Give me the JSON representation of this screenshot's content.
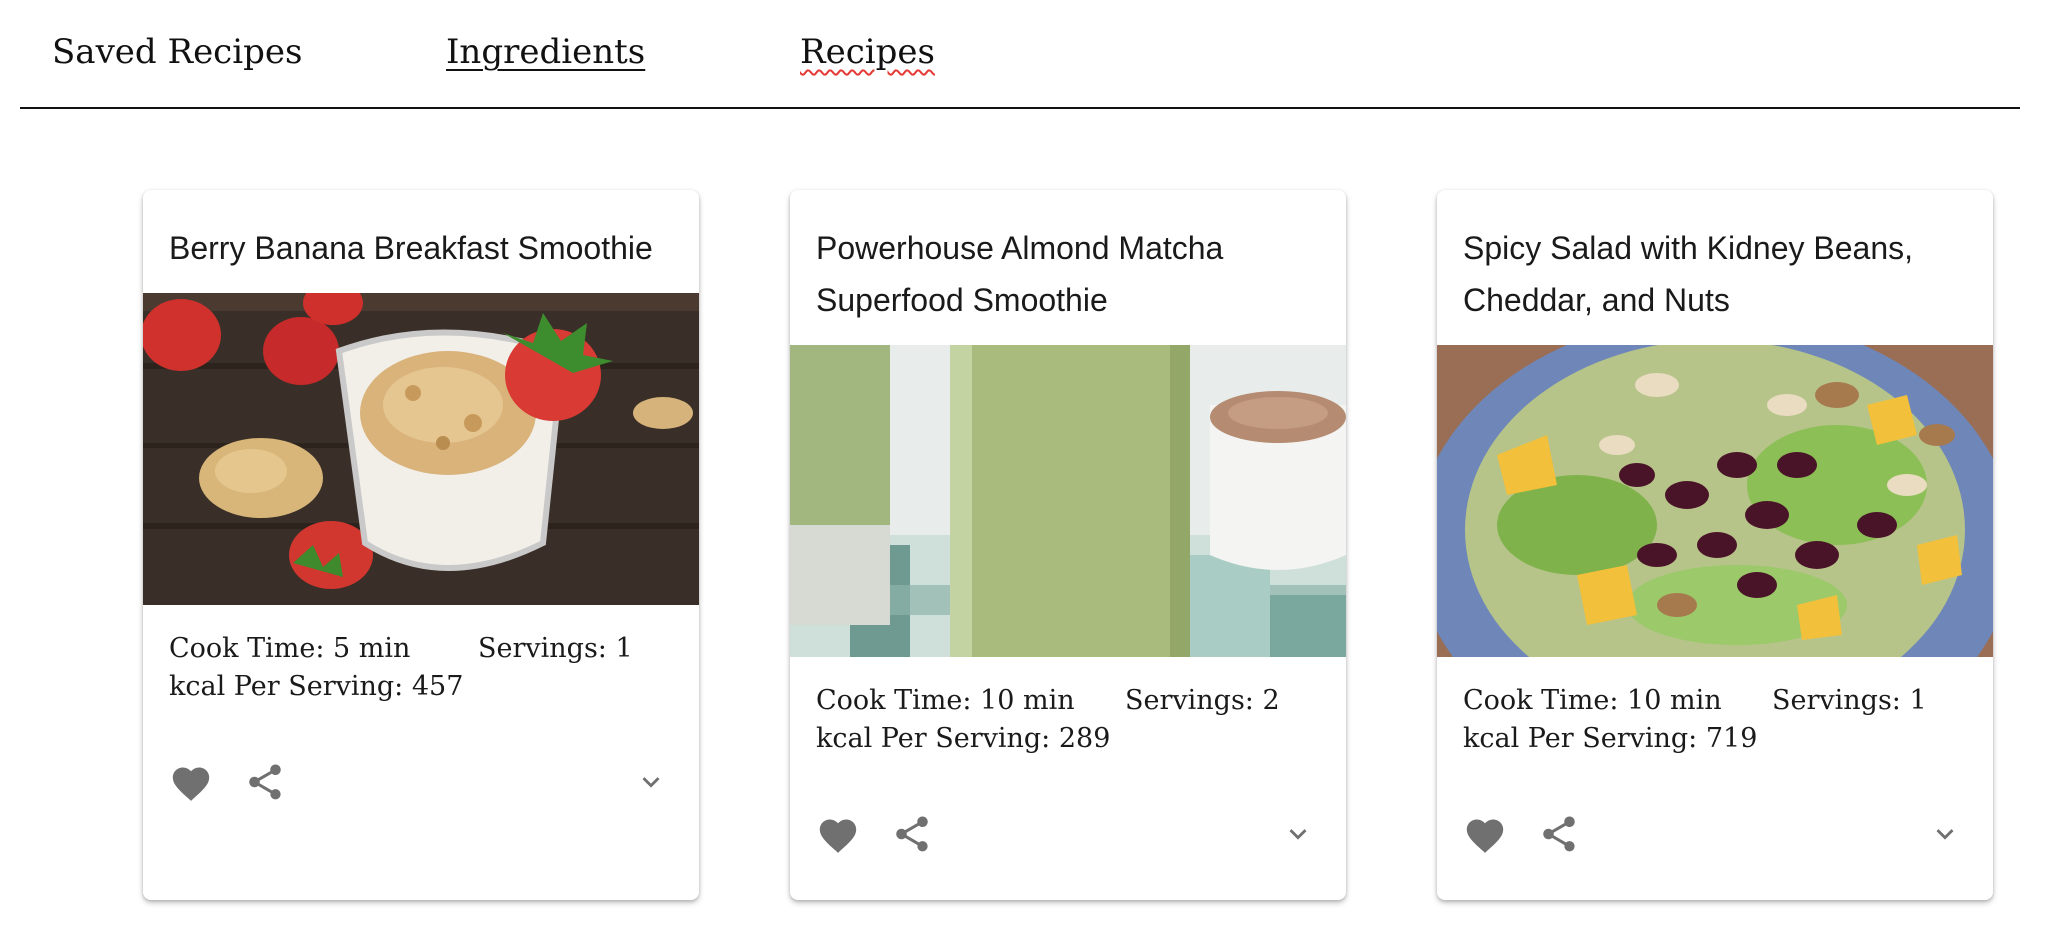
{
  "nav": {
    "saved": "Saved Recipes",
    "ingredients": "Ingredients",
    "recipes": "Recipes"
  },
  "labels": {
    "cook_time": "Cook Time:",
    "servings": "Servings:",
    "kcal": "kcal Per Serving:"
  },
  "recipes": [
    {
      "title": "Berry Banana Breakfast Smoothie",
      "cook_time": "5 min",
      "servings": "1",
      "kcal": "457",
      "image": "strawberry-smoothie-photo"
    },
    {
      "title": "Powerhouse Almond Matcha Superfood Smoothie",
      "cook_time": "10 min",
      "servings": "2",
      "kcal": "289",
      "image": "matcha-smoothie-photo"
    },
    {
      "title": "Spicy Salad with Kidney Beans, Cheddar, and Nuts",
      "cook_time": "10 min",
      "servings": "1",
      "kcal": "719",
      "image": "kidney-bean-salad-photo"
    }
  ],
  "icons": {
    "favorite": "heart-icon",
    "share": "share-icon",
    "expand": "chevron-down-icon"
  },
  "colors": {
    "icon": "#707070",
    "nav_rule": "#111111",
    "spellcheck_underline": "#e53935"
  }
}
